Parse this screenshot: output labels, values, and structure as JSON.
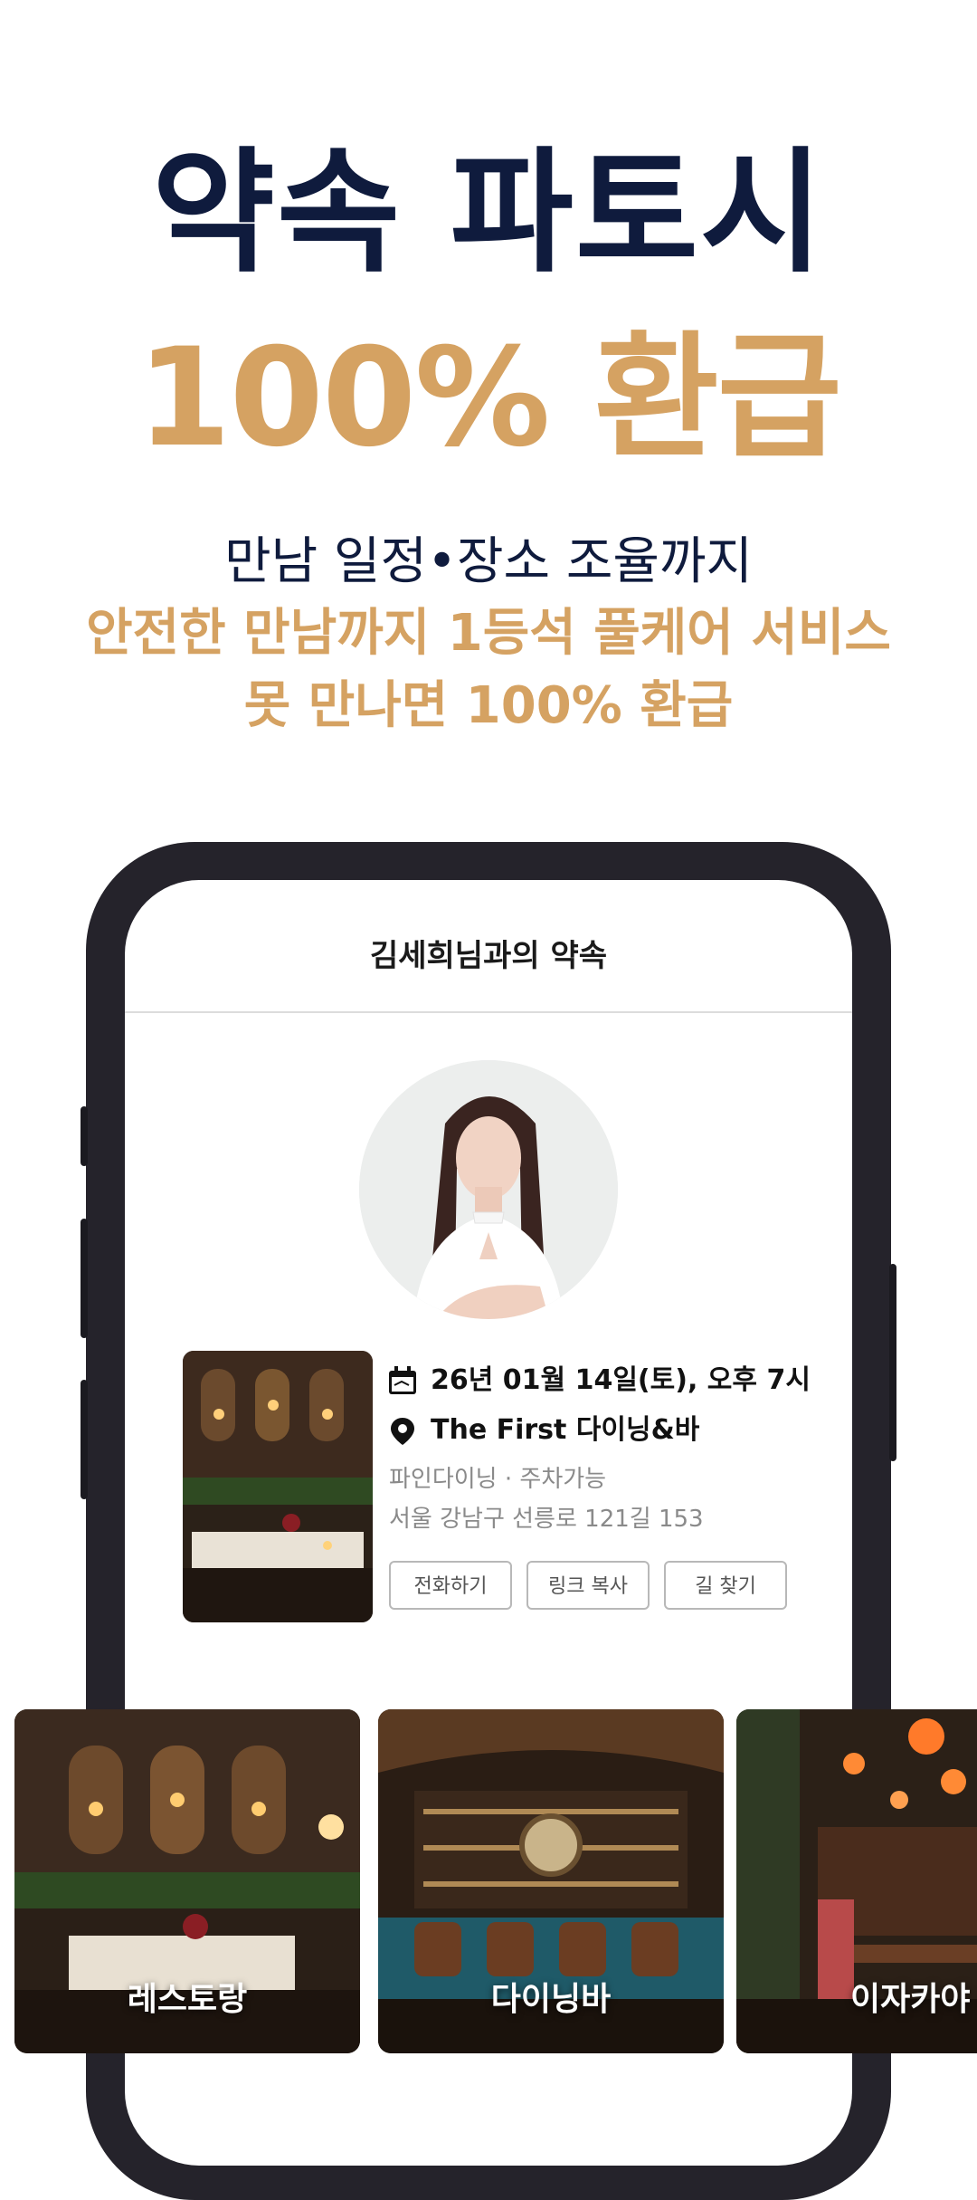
{
  "hero": {
    "title_line1": "약속 파토시",
    "title_line2": "100% 환급",
    "subtitle_line1": "만남 일정•장소 조율까지",
    "subtitle_line2": "안전한 만남까지 1등석 풀케어 서비스",
    "subtitle_line3": "못 만나면 100% 환급"
  },
  "screen": {
    "title": "김세희님과의 약속",
    "appointment": {
      "datetime": "26년 01월 14일(토), 오후 7시",
      "place": "The First 다이닝&바",
      "tags": "파인다이닝 · 주차가능",
      "address": "서울 강남구 선릉로 121길 153"
    },
    "buttons": {
      "call": "전화하기",
      "copy_link": "링크 복사",
      "directions": "길 찾기"
    }
  },
  "categories": [
    {
      "label": "레스토랑"
    },
    {
      "label": "다이닝바"
    },
    {
      "label": "이자카야"
    }
  ],
  "colors": {
    "navy": "#0f1b3d",
    "gold": "#d5a262",
    "phone_frame": "#25232b"
  },
  "icons": {
    "date": "calendar-icon",
    "place": "map-pin-icon"
  }
}
